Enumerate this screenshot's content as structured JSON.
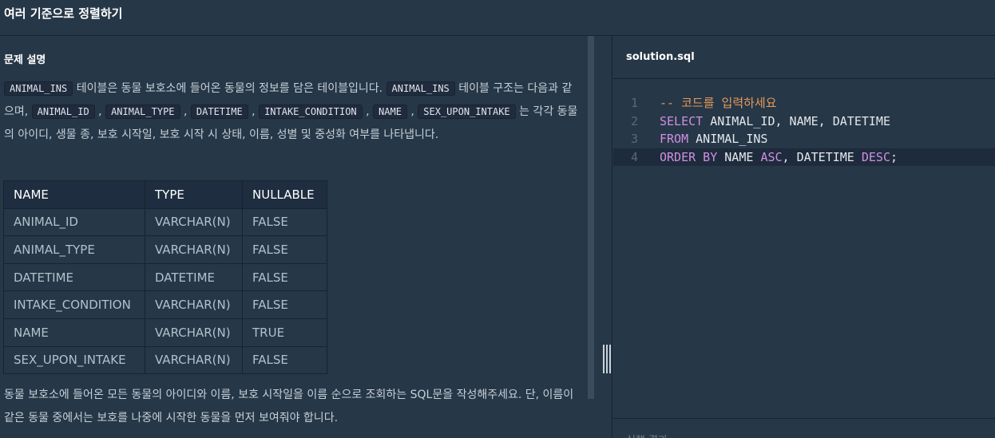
{
  "header": {
    "title": "여러 기준으로 정렬하기"
  },
  "problem": {
    "section_title": "문제 설명",
    "para1": {
      "code_animal_ins": "ANIMAL_INS",
      "text_a": " 테이블은 동물 보호소에 들어온 동물의 정보를 담은 테이블입니다. ",
      "code_animal_ins2": "ANIMAL_INS",
      "text_b": " 테이블 구조는 다음과 같으며, ",
      "code_animal_id": "ANIMAL_ID",
      "sep1": " , ",
      "code_animal_type": "ANIMAL_TYPE",
      "sep2": " , ",
      "code_datetime": "DATETIME",
      "sep3": " , ",
      "code_intake": "INTAKE_CONDITION",
      "sep4": " , ",
      "code_name": "NAME",
      "sep5": " , ",
      "code_sex": "SEX_UPON_INTAKE",
      "text_c": " 는 각각 동물의 아이디, 생물 종, 보호 시작일, 보호 시작 시 상태, 이름, 성별 및 중성화 여부를 나타냅니다."
    },
    "table": {
      "headers": [
        "NAME",
        "TYPE",
        "NULLABLE"
      ],
      "rows": [
        [
          "ANIMAL_ID",
          "VARCHAR(N)",
          "FALSE"
        ],
        [
          "ANIMAL_TYPE",
          "VARCHAR(N)",
          "FALSE"
        ],
        [
          "DATETIME",
          "DATETIME",
          "FALSE"
        ],
        [
          "INTAKE_CONDITION",
          "VARCHAR(N)",
          "FALSE"
        ],
        [
          "NAME",
          "VARCHAR(N)",
          "TRUE"
        ],
        [
          "SEX_UPON_INTAKE",
          "VARCHAR(N)",
          "FALSE"
        ]
      ]
    },
    "para2": "동물 보호소에 들어온 모든 동물의 아이디와 이름, 보호 시작일을 이름 순으로 조회하는 SQL문을 작성해주세요. 단, 이름이 같은 동물 중에서는 보호를 나중에 시작한 동물을 먼저 보여줘야 합니다."
  },
  "editor": {
    "filename": "solution.sql",
    "lines": [
      {
        "num": "1",
        "parts": [
          {
            "t": "-- 코드를 입력하세요",
            "c": "cm"
          }
        ]
      },
      {
        "num": "2",
        "parts": [
          {
            "t": "SELECT",
            "c": "kw"
          },
          {
            "t": " ANIMAL_ID, NAME, DATETIME",
            "c": ""
          }
        ]
      },
      {
        "num": "3",
        "parts": [
          {
            "t": "FROM",
            "c": "kw"
          },
          {
            "t": " ANIMAL_INS",
            "c": ""
          }
        ]
      },
      {
        "num": "4",
        "parts": [
          {
            "t": "ORDER BY",
            "c": "kw"
          },
          {
            "t": " NAME ",
            "c": ""
          },
          {
            "t": "ASC",
            "c": "kw"
          },
          {
            "t": ", DATETIME ",
            "c": ""
          },
          {
            "t": "DESC",
            "c": "kw"
          },
          {
            "t": ";",
            "c": ""
          }
        ]
      }
    ],
    "active_line": 4
  },
  "result": {
    "label": "실행 결과"
  },
  "colors": {
    "background": "#263747",
    "keyword": "#d08fe3",
    "comment": "#e89a5a"
  }
}
